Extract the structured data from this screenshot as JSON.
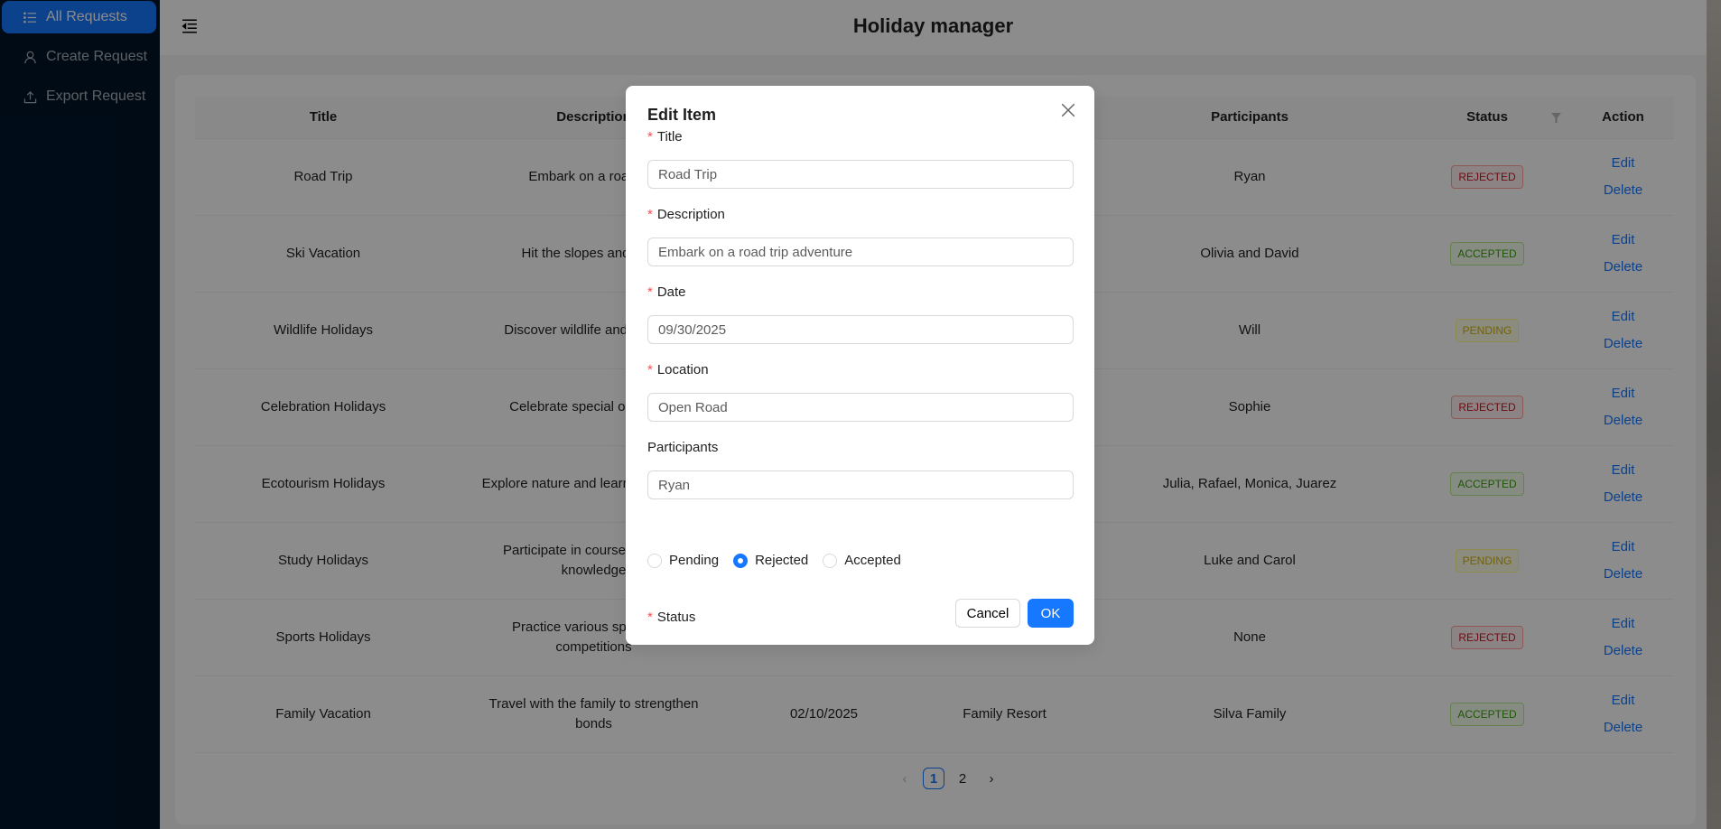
{
  "sidebar": {
    "items": [
      {
        "label": "All Requests",
        "icon": "list-icon",
        "active": true
      },
      {
        "label": "Create Request",
        "icon": "user-icon"
      },
      {
        "label": "Export Request",
        "icon": "upload-icon"
      }
    ]
  },
  "header": {
    "title": "Holiday manager"
  },
  "table": {
    "columns": [
      "Title",
      "Description",
      "",
      "",
      "Participants",
      "Status",
      "Action"
    ],
    "rows": [
      {
        "title": "Road Trip",
        "description": "Embark on a road trip",
        "date": "",
        "location": "",
        "participants": "Ryan",
        "status": "REJECTED"
      },
      {
        "title": "Ski Vacation",
        "description": "Hit the slopes and enjoy",
        "date": "",
        "location": "",
        "participants": "Olivia and David",
        "status": "ACCEPTED"
      },
      {
        "title": "Wildlife Holidays",
        "description": "Discover wildlife and experien",
        "date": "",
        "location": "",
        "participants": "Will",
        "status": "PENDING"
      },
      {
        "title": "Celebration Holidays",
        "description": "Celebrate special occasions",
        "date": "",
        "location": "",
        "participants": "Sophie",
        "status": "REJECTED"
      },
      {
        "title": "Ecotourism Holidays",
        "description": "Explore nature and learn ecosystems",
        "date": "",
        "location": "",
        "participants": "Julia, Rafael, Monica, Juarez",
        "status": "ACCEPTED"
      },
      {
        "title": "Study Holidays",
        "description": "Participate in courses and wor knowledge",
        "date": "",
        "location": "",
        "participants": "Luke and Carol",
        "status": "PENDING"
      },
      {
        "title": "Sports Holidays",
        "description": "Practice various sports and competitions",
        "date": "",
        "location": "",
        "participants": "None",
        "status": "REJECTED"
      },
      {
        "title": "Family Vacation",
        "description": "Travel with the family to strengthen bonds",
        "date": "02/10/2025",
        "location": "Family Resort",
        "participants": "Silva Family",
        "status": "ACCEPTED"
      }
    ],
    "edit_label": "Edit",
    "delete_label": "Delete"
  },
  "pagination": {
    "pages": [
      "1",
      "2"
    ],
    "current": "1"
  },
  "modal": {
    "title": "Edit Item",
    "fields": [
      {
        "label": "Title",
        "value": "Road Trip",
        "required": true
      },
      {
        "label": "Description",
        "value": "Embark on a road trip adventure",
        "required": true
      },
      {
        "label": "Date",
        "value": "09/30/2025",
        "required": true
      },
      {
        "label": "Location",
        "value": "Open Road",
        "required": true
      },
      {
        "label": "Participants",
        "value": "Ryan",
        "required": false
      }
    ],
    "status_label": "Status",
    "status_options": [
      "Pending",
      "Rejected",
      "Accepted"
    ],
    "status_selected": "Rejected",
    "cancel": "Cancel",
    "ok": "OK"
  },
  "colors": {
    "primary": "#1677ff",
    "sidebar": "#001529"
  }
}
